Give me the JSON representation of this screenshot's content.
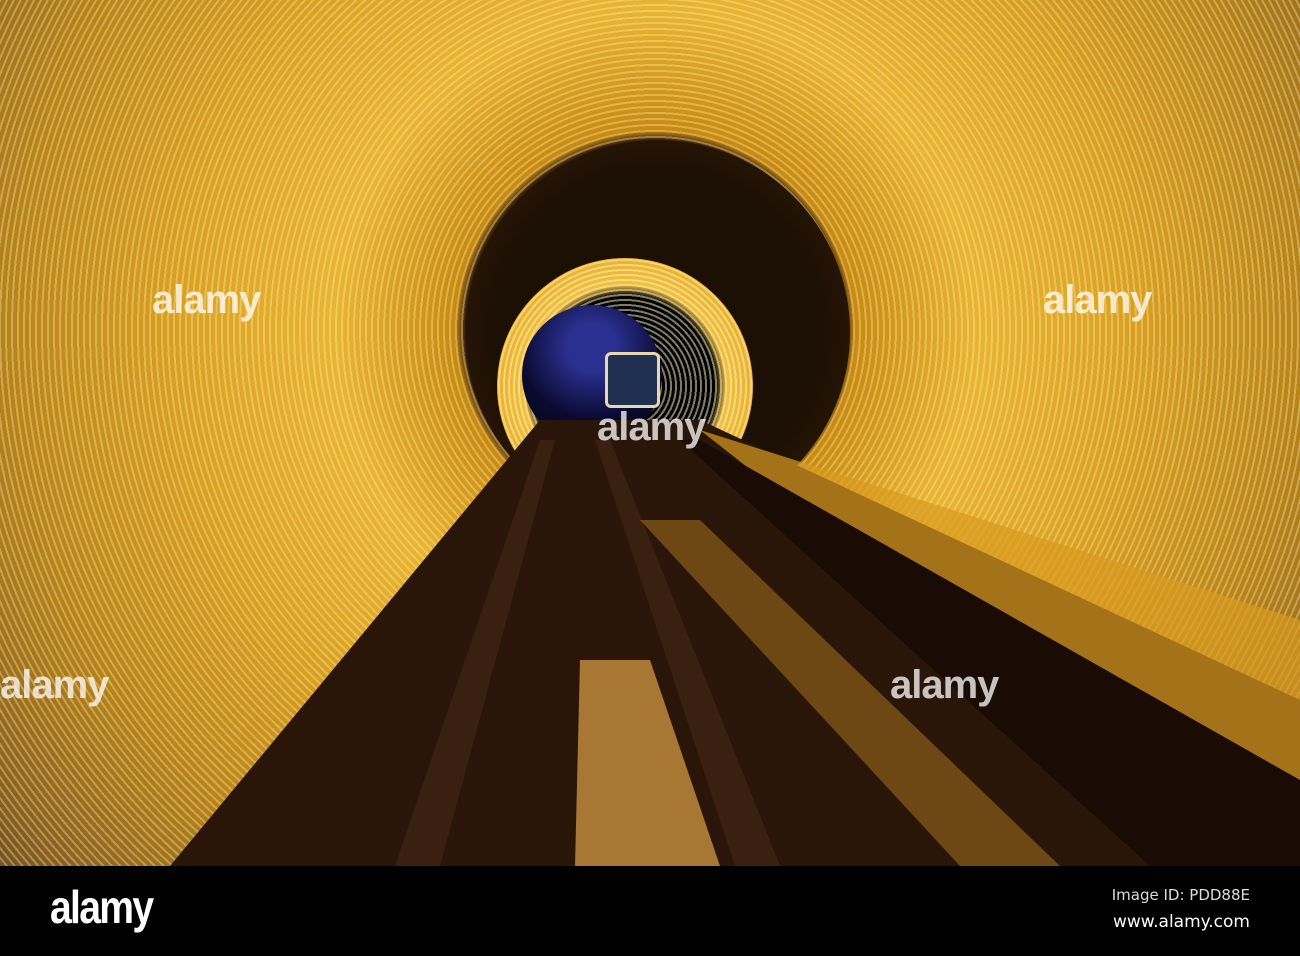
{
  "watermark": {
    "text": "alamy"
  },
  "footer": {
    "logo": "alamy",
    "image_id": "Image ID: PDD88E",
    "website": "www.alamy.com"
  },
  "colors": {
    "tunnel_glow": "#e9b530",
    "tunnel_dark": "#1c0f04",
    "footer_bg": "#000000"
  }
}
